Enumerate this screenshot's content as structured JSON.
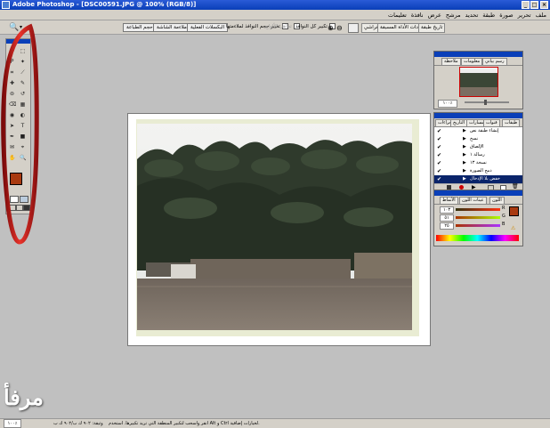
{
  "window": {
    "app": "Adobe Photoshop",
    "title": "Adobe Photoshop - [DSC00591.JPG @ 100% (RGB/8)]",
    "buttons": [
      "_",
      "□",
      "×"
    ]
  },
  "menu": {
    "items": [
      "ملف",
      "تحرير",
      "صورة",
      "طبقة",
      "تحديد",
      "مرشح",
      "عرض",
      "نافذة",
      "تعليمات"
    ]
  },
  "options_bar": {
    "tool_icon": "zoom-icon",
    "checkbox_resize_windows": "تغيير حجم النوافذ لملاءمتها",
    "checkbox_ignore_palettes": "تجاهل الألواح",
    "checkbox_zoom_all": "تكبير كل النوافذ",
    "btn_actual_pixels": "البكسلات الفعلية",
    "btn_fit_screen": "ملاءمة الشاشة",
    "btn_print_size": "حجم الطباعة",
    "tabs": [
      "فراشي",
      "إعدادات الأداة المسبقة",
      "تاريخ طبقة"
    ]
  },
  "toolbox": {
    "tools": [
      "move-icon",
      "marquee-icon",
      "lasso-icon",
      "magic-wand-icon",
      "crop-icon",
      "slice-icon",
      "heal-icon",
      "brush-icon",
      "stamp-icon",
      "history-brush-icon",
      "eraser-icon",
      "gradient-icon",
      "blur-icon",
      "dodge-icon",
      "path-select-icon",
      "type-icon",
      "pen-icon",
      "shape-icon",
      "notes-icon",
      "eyedropper-icon",
      "hand-icon",
      "zoom-tool-icon"
    ],
    "foreground_color": "#a93a10",
    "background_color": "#ffffff"
  },
  "navigator": {
    "tabs": [
      "ملاحظة",
      "معلومات",
      "رسم بياني"
    ],
    "zoom": "١٠٠٪"
  },
  "layers": {
    "tabs": [
      "طبقات",
      "قنوات",
      "مسارات",
      "التاريخ",
      "الإجراءات"
    ],
    "rows": [
      {
        "name": "إنشاء طبقة نص",
        "selected": false
      },
      {
        "name": "نسخ",
        "selected": false
      },
      {
        "name": "الإلصاق",
        "selected": false
      },
      {
        "name": "رسالة ١",
        "selected": false
      },
      {
        "name": "نسخة ١٣",
        "selected": false
      },
      {
        "name": "دمج الصورة",
        "selected": false
      },
      {
        "name": "خفض بلا الإدخال",
        "selected": true
      }
    ]
  },
  "color_panel": {
    "tabs": [
      "اللون",
      "عينات اللون",
      "الأنماط"
    ],
    "r_label": "R",
    "g_label": "G",
    "b_label": "B",
    "r": "١٠٣",
    "g": "٥١",
    "b": "٢٥",
    "swatch_color": "#a93a10"
  },
  "status": {
    "zoom": "١٠٠٪",
    "doc": "وثيقة: ٩٠٢ ك ب/٩٠٢ ك ب",
    "hint": "انقر واسحب لتكبير المنطقة التي تريد تكبيرها. استخدم Alt و Ctrl لخيارات إضافية."
  },
  "watermark": "مرفأ"
}
